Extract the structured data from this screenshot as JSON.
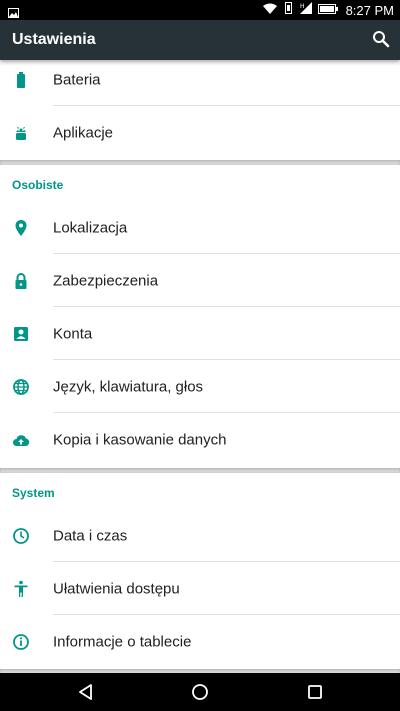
{
  "status_bar": {
    "time": "8:27 PM",
    "icons": [
      "image-notification-icon",
      "wifi-icon",
      "vibrate-icon",
      "signal-icon",
      "battery-icon"
    ]
  },
  "toolbar": {
    "title": "Ustawienia",
    "search_icon": "search-icon"
  },
  "device_section": {
    "items": [
      {
        "label": "Bateria",
        "icon": "battery-icon"
      },
      {
        "label": "Aplikacje",
        "icon": "android-icon"
      }
    ]
  },
  "personal_section": {
    "header": "Osobiste",
    "items": [
      {
        "label": "Lokalizacja",
        "icon": "location-icon"
      },
      {
        "label": "Zabezpieczenia",
        "icon": "lock-icon"
      },
      {
        "label": "Konta",
        "icon": "account-icon"
      },
      {
        "label": "Język, klawiatura, głos",
        "icon": "globe-icon"
      },
      {
        "label": "Kopia i kasowanie danych",
        "icon": "cloud-upload-icon"
      }
    ]
  },
  "system_section": {
    "header": "System",
    "items": [
      {
        "label": "Data i czas",
        "icon": "clock-icon"
      },
      {
        "label": "Ułatwienia dostępu",
        "icon": "accessibility-icon"
      },
      {
        "label": "Informacje o tablecie",
        "icon": "info-icon"
      }
    ]
  },
  "nav_bar": {
    "buttons": [
      "back-icon",
      "home-icon",
      "recents-icon"
    ]
  },
  "colors": {
    "toolbar": "#263238",
    "accent": "#009688",
    "status_bar": "#000000",
    "divider": "#e0e0e0"
  }
}
